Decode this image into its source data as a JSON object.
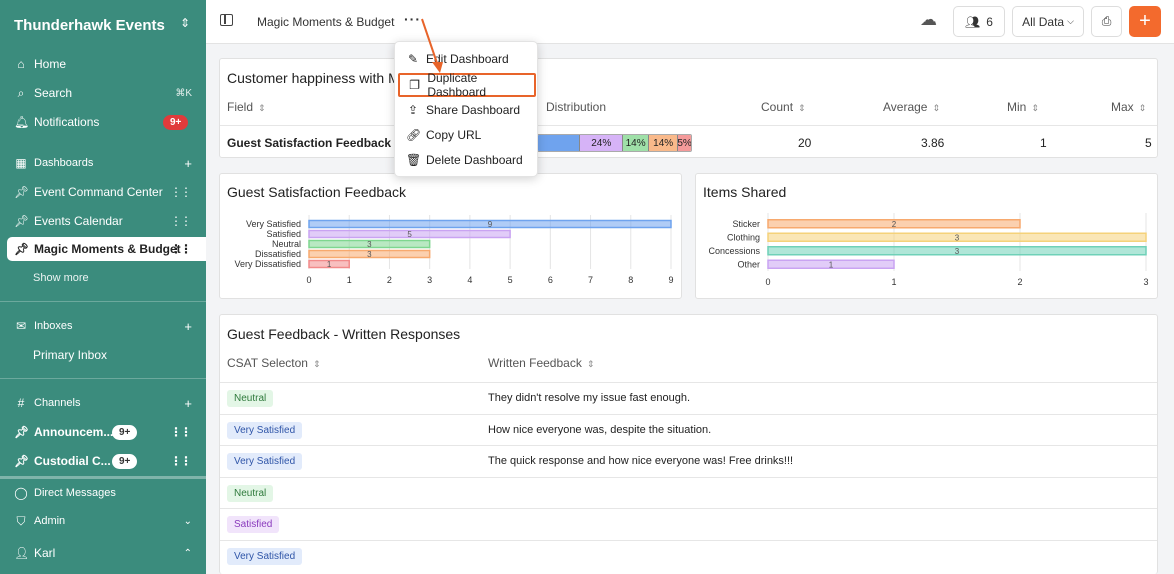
{
  "sidebar": {
    "workspace": "Thunderhawk Events",
    "home": "Home",
    "search": "Search",
    "search_kbd": "⌘K",
    "notifications": "Notifications",
    "notifications_badge": "9+",
    "dashboards_header": "Dashboards",
    "dashboards": [
      "Event Command Center",
      "Events Calendar",
      "Magic Moments & Budget"
    ],
    "show_more": "Show more",
    "inboxes_header": "Inboxes",
    "inbox_primary": "Primary Inbox",
    "channels_header": "Channels",
    "channels": [
      {
        "name": "Announcem...",
        "badge": "9+"
      },
      {
        "name": "Custodial C...",
        "badge": "9+"
      }
    ],
    "direct_messages": "Direct Messages",
    "admin": "Admin",
    "user": "Karl"
  },
  "topbar": {
    "title": "Magic Moments & Budget",
    "members_count": "6",
    "filter": "All Data"
  },
  "menu": {
    "items": [
      "Edit Dashboard",
      "Duplicate Dashboard",
      "Share Dashboard",
      "Copy URL",
      "Delete Dashboard"
    ]
  },
  "summary": {
    "title": "Customer happiness with M",
    "columns": [
      "Field",
      "Distribution",
      "Count",
      "Average",
      "Min",
      "Max"
    ],
    "row": {
      "field": "Guest Satisfaction Feedback",
      "count": "20",
      "average": "3.86",
      "min": "1",
      "max": "5"
    },
    "distribution": [
      {
        "label": "",
        "pct": 0.27,
        "color": "#6fa3ee"
      },
      {
        "label": "24%",
        "pct": 0.28,
        "color": "#d6b3f7"
      },
      {
        "label": "14%",
        "pct": 0.17,
        "color": "#9fe0a8"
      },
      {
        "label": "14%",
        "pct": 0.19,
        "color": "#f9b98a"
      },
      {
        "label": "5%",
        "pct": 0.09,
        "color": "#f49a9a"
      }
    ]
  },
  "chart_data": [
    {
      "type": "bar",
      "orientation": "horizontal",
      "title": "Guest Satisfaction Feedback",
      "categories": [
        "Very Satisfied",
        "Satisfied",
        "Neutral",
        "Dissatisfied",
        "Very Dissatisfied"
      ],
      "values": [
        9,
        5,
        3,
        3,
        1
      ],
      "colors": [
        "#6fa3ee",
        "#c9a3f2",
        "#7fd68f",
        "#f7a96e",
        "#f28a8a"
      ],
      "xlim": [
        0,
        9
      ],
      "xticks": [
        0,
        1,
        2,
        3,
        4,
        5,
        6,
        7,
        8,
        9
      ],
      "grid": true
    },
    {
      "type": "bar",
      "orientation": "horizontal",
      "title": "Items Shared",
      "categories": [
        "Sticker",
        "Clothing",
        "Concessions",
        "Other"
      ],
      "values": [
        2,
        3,
        3,
        1
      ],
      "colors": [
        "#f7a96e",
        "#f5d27a",
        "#6fd1b8",
        "#c9a3f2"
      ],
      "xlim": [
        0,
        3
      ],
      "xticks": [
        0,
        1,
        2,
        3
      ],
      "grid": true
    }
  ],
  "feedback": {
    "title": "Guest Feedback - Written Responses",
    "columns": [
      "CSAT Selecton",
      "Written Feedback"
    ],
    "rows": [
      {
        "tag": "Neutral",
        "text": "They didn't resolve my issue fast enough."
      },
      {
        "tag": "Very Satisfied",
        "text": "How nice everyone was, despite the situation."
      },
      {
        "tag": "Very Satisfied",
        "text": "The quick response and how nice everyone was!  Free drinks!!!"
      },
      {
        "tag": "Neutral",
        "text": ""
      },
      {
        "tag": "Satisfied",
        "text": ""
      },
      {
        "tag": "Very Satisfied",
        "text": ""
      }
    ],
    "tag_styles": {
      "Neutral": {
        "bg": "#e3f6e6",
        "fg": "#2f7a3c"
      },
      "Very Satisfied": {
        "bg": "#e2ebfb",
        "fg": "#2f55a8"
      },
      "Satisfied": {
        "bg": "#f1e4fb",
        "fg": "#8a3bbd"
      }
    }
  },
  "colors": {
    "sidebar_bg": "#3b8c7d",
    "accent": "#f36a2d",
    "badge_red": "#e03b3b",
    "highlight": "#e8642a"
  }
}
